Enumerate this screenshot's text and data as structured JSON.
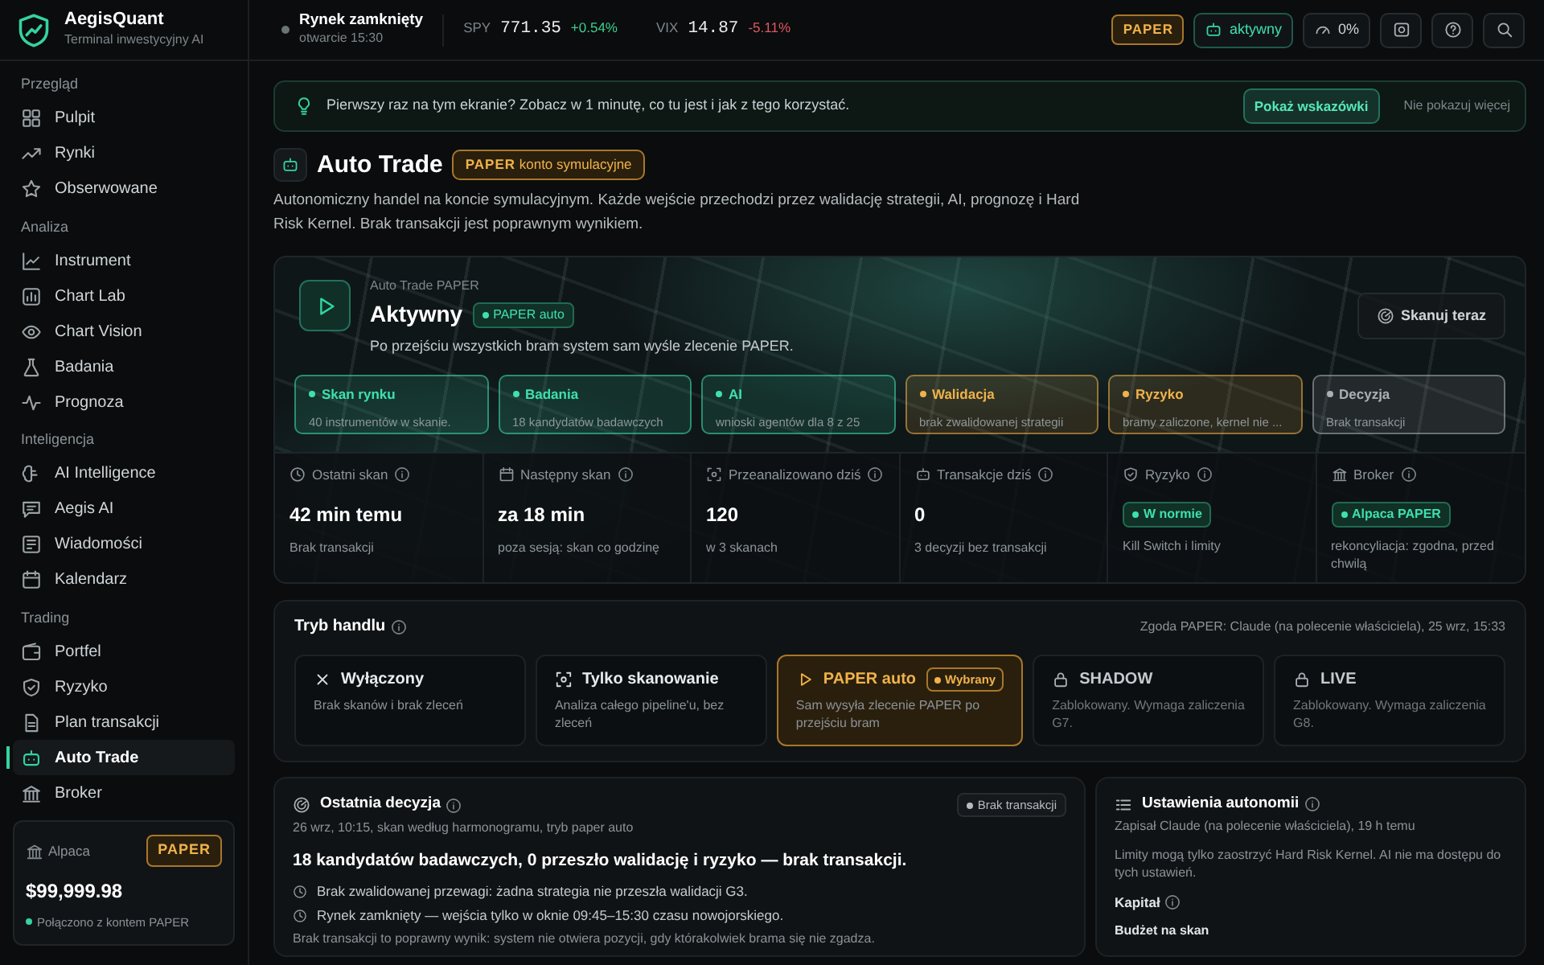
{
  "topbar": {
    "brand": {
      "name": "AegisQuant",
      "subtitle": "Terminal inwestycyjny AI"
    },
    "market": {
      "status": "Rynek zamknięty",
      "opening": "otwarcie 15:30",
      "open": false
    },
    "tickers": [
      {
        "symbol": "SPY",
        "value": "771.35",
        "change": "+0.54%",
        "color": "#3ecf8e"
      },
      {
        "symbol": "VIX",
        "value": "14.87",
        "change": "-5.11%",
        "color": "#e0595f"
      }
    ],
    "mode_badge": "PAPER",
    "autotrade_button": "aktywny",
    "exposure": "0%"
  },
  "sidebar": {
    "sections": [
      {
        "title": "Przegląd",
        "items": [
          {
            "label": "Pulpit",
            "selected": false
          },
          {
            "label": "Rynki",
            "selected": false
          },
          {
            "label": "Obserwowane",
            "selected": false
          }
        ]
      },
      {
        "title": "Analiza",
        "items": [
          {
            "label": "Instrument",
            "selected": false
          },
          {
            "label": "Chart Lab",
            "selected": false
          },
          {
            "label": "Chart Vision",
            "selected": false
          },
          {
            "label": "Badania",
            "selected": false
          },
          {
            "label": "Prognoza",
            "selected": false
          }
        ]
      },
      {
        "title": "Inteligencja",
        "items": [
          {
            "label": "AI Intelligence",
            "selected": false
          },
          {
            "label": "Aegis AI",
            "selected": false
          },
          {
            "label": "Wiadomości",
            "selected": false
          },
          {
            "label": "Kalendarz",
            "selected": false
          }
        ]
      },
      {
        "title": "Trading",
        "items": [
          {
            "label": "Portfel",
            "selected": false
          },
          {
            "label": "Ryzyko",
            "selected": false
          },
          {
            "label": "Plan transakcji",
            "selected": false
          },
          {
            "label": "Auto Trade",
            "selected": true
          },
          {
            "label": "Broker",
            "selected": false
          }
        ]
      }
    ],
    "account": {
      "broker": "Alpaca",
      "badge": "PAPER",
      "balance": "$99,999.98",
      "status": "Połączono z kontem PAPER",
      "connected": true
    }
  },
  "banner": {
    "text": "Pierwszy raz na tym ekranie? Zobacz w 1 minutę, co tu jest i jak z tego korzystać.",
    "primary_button": "Pokaż wskazówki",
    "secondary_button": "Nie pokazuj więcej"
  },
  "header": {
    "title": "Auto Trade",
    "badge_mode": "PAPER",
    "badge_text": "konto symulacyjne",
    "description": "Autonomiczny handel na koncie symulacyjnym. Każde wejście przechodzi przez walidację strategii, AI, prognozę i Hard Risk Kernel. Brak transakcji jest poprawnym wynikiem."
  },
  "hero": {
    "eyebrow": "Auto Trade PAPER",
    "status": "Aktywny",
    "status_badge": "PAPER auto",
    "subtitle": "Po przejściu wszystkich bram system sam wyśle zlecenie PAPER.",
    "scan_button": "Skanuj teraz",
    "stages": [
      {
        "name": "Skan rynku",
        "detail": "40 instrumentów w skanie.",
        "color": "#3ee0ad"
      },
      {
        "name": "Badania",
        "detail": "18 kandydatów badawczych",
        "color": "#3ee0ad"
      },
      {
        "name": "AI",
        "detail": "wnioski agentów dla 8 z 25",
        "color": "#3ee0ad"
      },
      {
        "name": "Walidacja",
        "detail": "brak zwalidowanej strategii",
        "color": "#f0b24a"
      },
      {
        "name": "Ryzyko",
        "detail": "bramy zaliczone, kernel nie ...",
        "color": "#f0b24a"
      },
      {
        "name": "Decyzja",
        "detail": "Brak transakcji",
        "color": "#a9b0b3"
      }
    ],
    "stats": [
      {
        "label": "Ostatni skan",
        "kind": "text",
        "value": "42 min temu",
        "note": "Brak transakcji"
      },
      {
        "label": "Następny skan",
        "kind": "text",
        "value": "za 18 min",
        "note": "poza sesją: skan co godzinę"
      },
      {
        "label": "Przeanalizowano dziś",
        "kind": "text",
        "value": "120",
        "note": "w 3 skanach"
      },
      {
        "label": "Transakcje dziś",
        "kind": "text",
        "value": "0",
        "note": "3 decyzji bez transakcji"
      },
      {
        "label": "Ryzyko",
        "kind": "badge",
        "value": "W normie",
        "note": "Kill Switch i limity"
      },
      {
        "label": "Broker",
        "kind": "badge",
        "value": "Alpaca PAPER",
        "note": "rekoncyliacja: zgodna, przed chwilą"
      }
    ]
  },
  "trade_mode": {
    "title": "Tryb handlu",
    "consent": "Zgoda PAPER: Claude (na polecenie właściciela), 25 wrz, 15:33",
    "options": [
      {
        "name": "Wyłączony",
        "description": "Brak skanów i brak zleceń",
        "selected": false,
        "locked": false
      },
      {
        "name": "Tylko skanowanie",
        "description": "Analiza całego pipeline'u, bez zleceń",
        "selected": false,
        "locked": false
      },
      {
        "name": "PAPER auto",
        "description": "Sam wysyła zlecenie PAPER po przejściu bram",
        "selected": true,
        "locked": false,
        "badge": "Wybrany"
      },
      {
        "name": "SHADOW",
        "description": "Zablokowany. Wymaga zaliczenia G7.",
        "selected": false,
        "locked": true
      },
      {
        "name": "LIVE",
        "description": "Zablokowany. Wymaga zaliczenia G8.",
        "selected": false,
        "locked": true
      }
    ]
  },
  "last_decision": {
    "title": "Ostatnia decyzja",
    "meta": "26 wrz, 10:15, skan według harmonogramu, tryb paper auto",
    "status_badge": "Brak transakcji",
    "headline": "18 kandydatów badawczych, 0 przeszło walidację i ryzyko — brak transakcji.",
    "reasons": [
      "Brak zwalidowanej przewagi: żadna strategia nie przeszła walidacji G3.",
      "Rynek zamknięty — wejścia tylko w oknie 09:45–15:30 czasu nowojorskiego."
    ],
    "footer": "Brak transakcji to poprawny wynik: system nie otwiera pozycji, gdy którakolwiek brama się nie zgadza."
  },
  "autonomy": {
    "title": "Ustawienia autonomii",
    "meta": "Zapisał Claude (na polecenie właściciela), 19 h temu",
    "note": "Limity mogą tylko zaostrzyć Hard Risk Kernel. AI nie ma dostępu do tych ustawień.",
    "capital_label": "Kapitał",
    "budget_label": "Budżet na skan"
  }
}
